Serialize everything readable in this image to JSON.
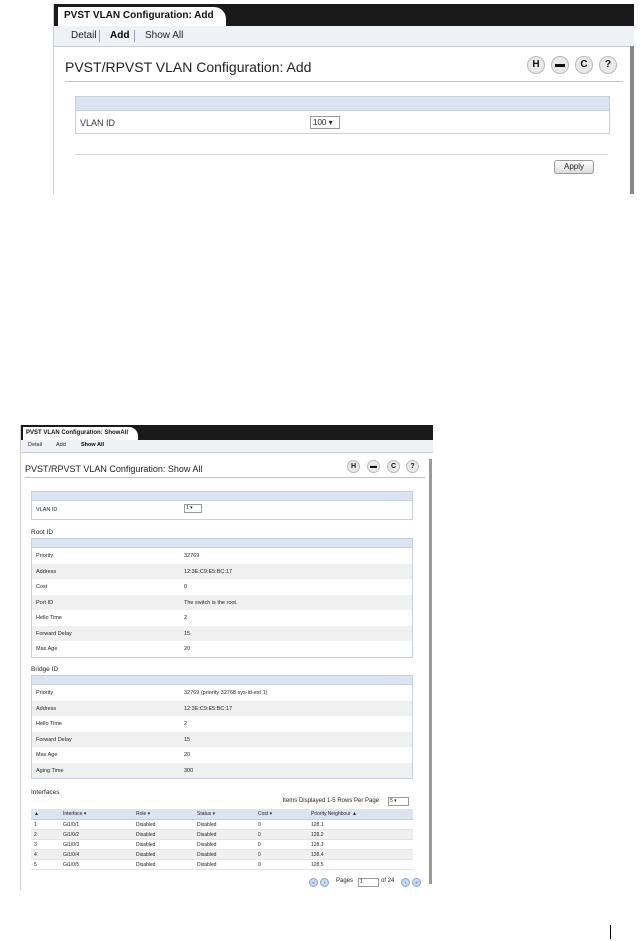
{
  "add_panel": {
    "tab_title": "PVST VLAN Configuration: Add",
    "nav": [
      "Detail",
      "Add",
      "Show All"
    ],
    "heading": "PVST/RPVST VLAN Configuration: Add",
    "icons": [
      "save-icon",
      "print-icon",
      "refresh-icon",
      "help-icon"
    ],
    "vlan_label": "VLAN ID",
    "vlan_value": "100 ▾",
    "apply_label": "Apply"
  },
  "showall_panel": {
    "tab_title": "PVST VLAN Configuration: ShowAll",
    "nav": [
      "Detail",
      "Add",
      "Show All"
    ],
    "heading": "PVST/RPVST VLAN Configuration: Show All",
    "vlan_label": "VLAN ID",
    "vlan_value": "1 ▾",
    "root_title": "Root ID",
    "root_rows": [
      {
        "k": "Priority",
        "v": "32769"
      },
      {
        "k": "Address",
        "v": "12:3E:C9:E5:BC:17"
      },
      {
        "k": "Cost",
        "v": "0"
      },
      {
        "k": "Port ID",
        "v": "The switch is the root."
      },
      {
        "k": "Hello Time",
        "v": "2"
      },
      {
        "k": "Forward Delay",
        "v": "15"
      },
      {
        "k": "Max Age",
        "v": "20"
      }
    ],
    "bridge_title": "Bridge ID",
    "bridge_rows": [
      {
        "k": "Priority",
        "v": "32769 (priority 32768 sys-id-ext 1)"
      },
      {
        "k": "Address",
        "v": "12:3E:C9:E5:BC:17"
      },
      {
        "k": "Hello Time",
        "v": "2"
      },
      {
        "k": "Forward Delay",
        "v": "15"
      },
      {
        "k": "Max Age",
        "v": "20"
      },
      {
        "k": "Aging Time",
        "v": "300"
      }
    ],
    "interfaces_title": "Interfaces",
    "items_displayed": "Items Displayed 1-5    Rows Per Page",
    "rows_per_page": "5 ▾",
    "columns": [
      "▲",
      "Interface ▾",
      "Role ▾",
      "Status ▾",
      "Cost ▾",
      "Priority.Neighbour ▲"
    ],
    "interfaces": [
      [
        "1",
        "Gi1/0/1",
        "Disabled",
        "Disabled",
        "0",
        "128.1"
      ],
      [
        "2",
        "Gi1/0/2",
        "Disabled",
        "Disabled",
        "0",
        "128.2"
      ],
      [
        "3",
        "Gi1/0/3",
        "Disabled",
        "Disabled",
        "0",
        "128.3"
      ],
      [
        "4",
        "Gi1/0/4",
        "Disabled",
        "Disabled",
        "0",
        "128.4"
      ],
      [
        "5",
        "Gi1/0/5",
        "Disabled",
        "Disabled",
        "0",
        "128.5"
      ]
    ],
    "pages_label": "Pages",
    "page_value": "1",
    "page_total": "of 24"
  }
}
